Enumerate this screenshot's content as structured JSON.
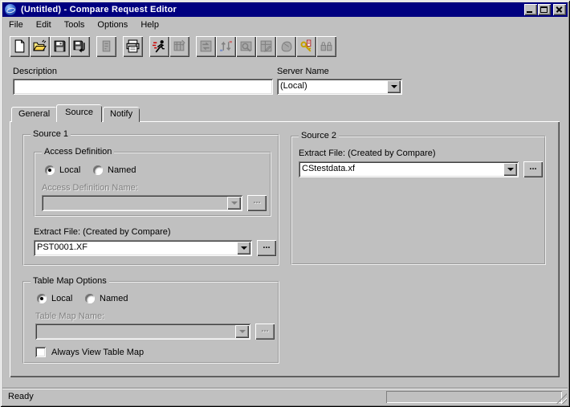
{
  "window": {
    "title": "(Untitled) - Compare Request Editor",
    "background_color": "#c0c0c0",
    "titlebar_color": "#000080",
    "titlebar_text_color": "#ffffff"
  },
  "menu": {
    "items": [
      {
        "label": "File"
      },
      {
        "label": "Edit"
      },
      {
        "label": "Tools"
      },
      {
        "label": "Options"
      },
      {
        "label": "Help"
      }
    ]
  },
  "toolbar": {
    "buttons": [
      {
        "icon": "new-icon",
        "disabled": false
      },
      {
        "icon": "open-icon",
        "disabled": false
      },
      {
        "icon": "save-icon",
        "disabled": false
      },
      {
        "icon": "save-as-icon",
        "disabled": false
      },
      {
        "icon": "definition-icon",
        "disabled": true
      },
      {
        "icon": "print-icon",
        "disabled": false
      },
      {
        "icon": "run-icon",
        "disabled": false
      },
      {
        "icon": "compare-results-icon",
        "disabled": true
      },
      {
        "icon": "swap-sources-icon",
        "disabled": true
      },
      {
        "icon": "sort-columns-icon",
        "disabled": true
      },
      {
        "icon": "browse-data-icon",
        "disabled": true
      },
      {
        "icon": "edit-table-icon",
        "disabled": true
      },
      {
        "icon": "service-icon",
        "disabled": true
      },
      {
        "icon": "keys-icon",
        "disabled": false
      },
      {
        "icon": "security-icon",
        "disabled": true
      }
    ]
  },
  "fields": {
    "description": {
      "label": "Description",
      "value": ""
    },
    "server_name": {
      "label": "Server Name",
      "value": "(Local)"
    }
  },
  "tabs": [
    {
      "label": "General",
      "active": false
    },
    {
      "label": "Source",
      "active": true
    },
    {
      "label": "Notify",
      "active": false
    }
  ],
  "source1": {
    "title": "Source 1",
    "access_definition": {
      "title": "Access Definition",
      "options": [
        {
          "label": "Local",
          "selected": true
        },
        {
          "label": "Named",
          "selected": false
        }
      ],
      "name_label": "Access Definition Name:",
      "name_value": "",
      "name_enabled": false
    },
    "extract_file": {
      "label": "Extract File: (Created by Compare)",
      "value": "PST0001.XF"
    }
  },
  "source2": {
    "title": "Source 2",
    "extract_file": {
      "label": "Extract File: (Created by Compare)",
      "value": "CStestdata.xf"
    }
  },
  "table_map": {
    "title": "Table Map Options",
    "options": [
      {
        "label": "Local",
        "selected": true
      },
      {
        "label": "Named",
        "selected": false
      }
    ],
    "name_label": "Table Map Name:",
    "name_value": "",
    "name_enabled": false,
    "checkbox": {
      "label": "Always View Table Map",
      "checked": false
    }
  },
  "controls": {
    "browse_label": "..."
  },
  "status_bar": {
    "text": "Ready"
  }
}
